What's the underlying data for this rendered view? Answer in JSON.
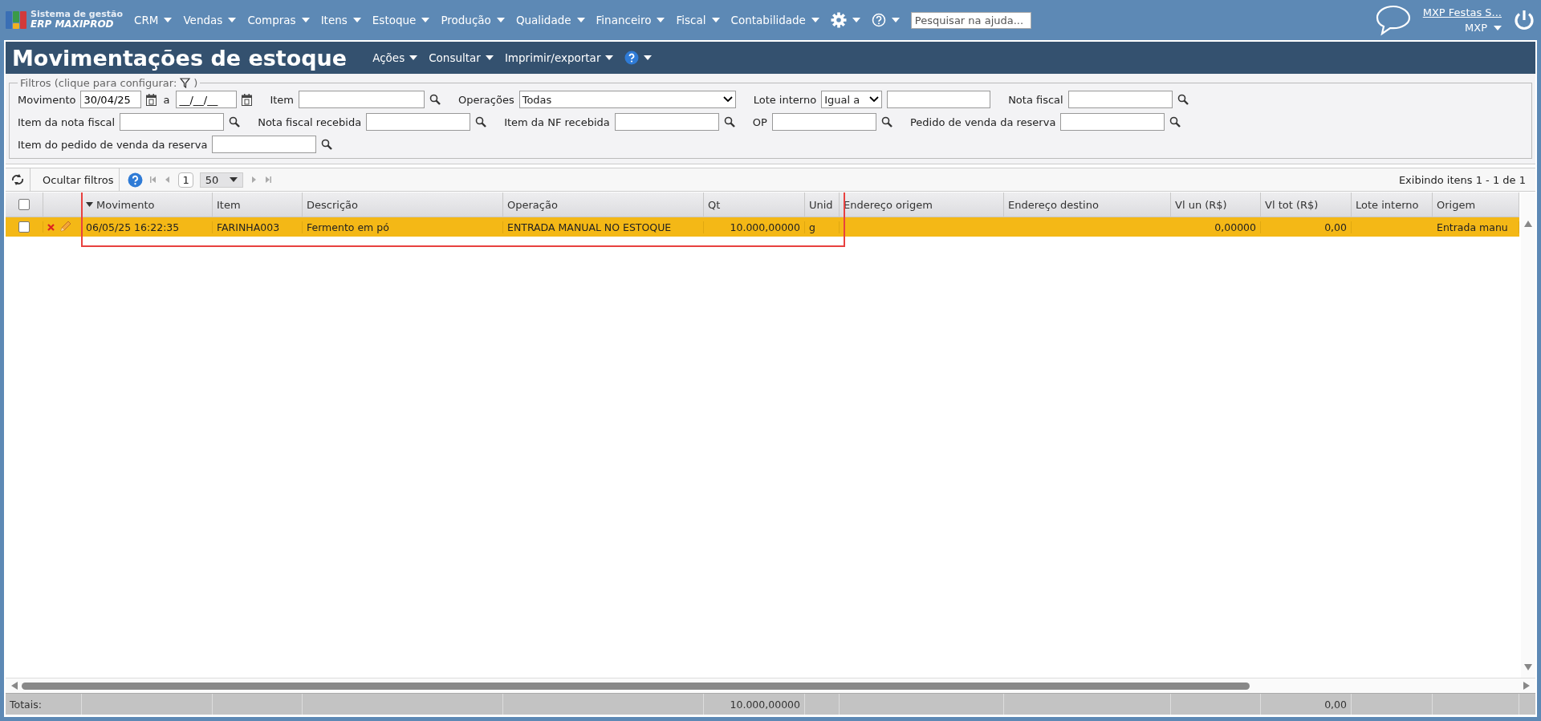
{
  "app": {
    "logo_line1": "Sistema de gestão",
    "logo_line2": "ERP MAXIPROD"
  },
  "menu": [
    {
      "label": "CRM"
    },
    {
      "label": "Vendas"
    },
    {
      "label": "Compras"
    },
    {
      "label": "Itens"
    },
    {
      "label": "Estoque"
    },
    {
      "label": "Produção"
    },
    {
      "label": "Qualidade"
    },
    {
      "label": "Financeiro"
    },
    {
      "label": "Fiscal"
    },
    {
      "label": "Contabilidade"
    }
  ],
  "help_search": {
    "placeholder": "Pesquisar na ajuda..."
  },
  "user": {
    "company": "MXP Festas S...",
    "account": "MXP"
  },
  "page": {
    "title": "Movimentações de estoque",
    "actions": [
      {
        "label": "Ações"
      },
      {
        "label": "Consultar"
      },
      {
        "label": "Imprimir/exportar"
      }
    ]
  },
  "filters": {
    "legend": "Filtros (clique para configurar:",
    "legend_end": ")",
    "rows": [
      [
        {
          "kind": "date-range",
          "label": "Movimento",
          "value": "30/04/25",
          "separator": "a",
          "value_to": "__/__/__"
        },
        {
          "kind": "lookup",
          "label": "Item"
        },
        {
          "kind": "select",
          "label": "Operações",
          "value": "Todas"
        },
        {
          "kind": "compare",
          "label": "Lote interno",
          "value": "Igual a"
        },
        {
          "kind": "lookup",
          "label": "Nota fiscal"
        }
      ],
      [
        {
          "kind": "lookup",
          "label": "Item da nota fiscal"
        },
        {
          "kind": "lookup",
          "label": "Nota fiscal recebida"
        },
        {
          "kind": "lookup",
          "label": "Item da NF recebida"
        },
        {
          "kind": "lookup",
          "label": "OP"
        },
        {
          "kind": "lookup",
          "label": "Pedido de venda da reserva"
        }
      ],
      [
        {
          "kind": "lookup",
          "label": "Item do pedido de venda da reserva"
        }
      ]
    ]
  },
  "toolbar": {
    "hide_filters": "Ocultar filtros",
    "page": "1",
    "page_size": "50",
    "status": "Exibindo itens 1 - 1 de 1"
  },
  "table": {
    "all_checked": false,
    "columns": [
      {
        "label": "Movimento",
        "sorted": true
      },
      {
        "label": "Item",
        "sorted": false
      },
      {
        "label": "Descrição",
        "sorted": false
      },
      {
        "label": "Operação",
        "sorted": false
      },
      {
        "label": "Qt",
        "sorted": false,
        "total": "10.000,00000"
      },
      {
        "label": "Unid",
        "sorted": false
      },
      {
        "label": "Endereço origem",
        "sorted": false
      },
      {
        "label": "Endereço destino",
        "sorted": false
      },
      {
        "label": "Vl un (R$)",
        "sorted": false
      },
      {
        "label": "Vl tot (R$)",
        "sorted": false,
        "total": "0,00"
      },
      {
        "label": "Lote interno",
        "sorted": false
      },
      {
        "label": "Origem",
        "sorted": false
      }
    ],
    "rows": [
      {
        "selected": true,
        "checked": false,
        "cells": [
          "06/05/25 16:22:35",
          "FARINHA003",
          "Fermento em pó",
          "ENTRADA MANUAL NO ESTOQUE",
          "10.000,00000",
          "g",
          "",
          "",
          "0,00000",
          "0,00",
          "",
          "Entrada manu"
        ]
      }
    ],
    "totals_label": "Totais:"
  }
}
